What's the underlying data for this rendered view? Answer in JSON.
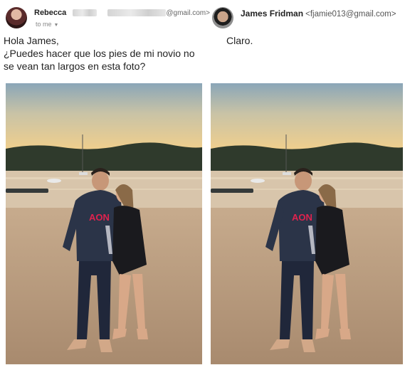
{
  "left_email": {
    "sender_name": "Rebecca",
    "email_suffix": "@gmail.com>",
    "to_label": "to me",
    "avatar_icon": "rebecca-avatar",
    "message_lines": [
      "Hola James,",
      "¿Puedes hacer que los pies de mi novio no",
      "se vean tan largos en esta foto?"
    ],
    "photo_logo": "AON"
  },
  "right_email": {
    "sender_name": "James Fridman",
    "sender_email": "<fjamie013@gmail.com>",
    "avatar_icon": "james-avatar",
    "message": "Claro.",
    "photo_logo": "AON"
  },
  "colors": {
    "sky_top": "#8fa9b8",
    "sky_glow": "#f1cf8c",
    "water": "#d9c6ad",
    "sand": "#b39579",
    "hoodie": "#2b3448",
    "logo_red": "#e0224e"
  }
}
